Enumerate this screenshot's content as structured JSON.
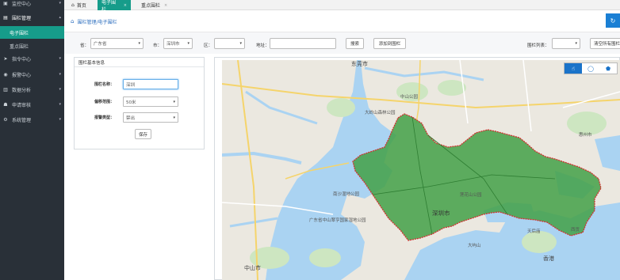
{
  "sidebar": {
    "items": [
      {
        "label": "监控中心",
        "icon": "monitor-icon"
      },
      {
        "label": "围栏管理",
        "icon": "fence-icon"
      },
      {
        "label": "指令中心",
        "icon": "command-icon"
      },
      {
        "label": "报警中心",
        "icon": "alarm-icon"
      },
      {
        "label": "数据分析",
        "icon": "chart-icon"
      },
      {
        "label": "申请审核",
        "icon": "review-icon"
      },
      {
        "label": "系统管理",
        "icon": "settings-icon"
      }
    ],
    "sub_items": [
      {
        "label": "电子围栏",
        "active": true
      },
      {
        "label": "重点围栏",
        "active": false
      }
    ]
  },
  "tabs": [
    {
      "label": "首页",
      "icon": "home-icon"
    },
    {
      "label": "电子围栏",
      "active": true
    },
    {
      "label": "重点围栏"
    }
  ],
  "breadcrumb": "围栏管理/电子围栏",
  "filter": {
    "province_label": "省：",
    "province_value": "广东省",
    "city_label": "市：",
    "city_value": "深圳市",
    "district_label": "区：",
    "district_value": "",
    "address_label": "地址：",
    "address_value": "",
    "search_button": "搜索",
    "add_button": "添加到围栏",
    "fence_list_label": "围栏列表：",
    "fence_list_value": "",
    "clear_button": "清空所有围栏"
  },
  "panel": {
    "title": "围栏基本信息",
    "name_label": "围栏名称：",
    "name_value": "深圳",
    "deviation_label": "偏移范围：",
    "deviation_value": "50米",
    "alarm_label": "报警类型：",
    "alarm_value": "禁出",
    "save_button": "保存"
  },
  "map": {
    "tools": [
      "hand-icon",
      "circle-icon",
      "polygon-icon"
    ],
    "labels": [
      {
        "text": "东莞市",
        "cls": "city"
      },
      {
        "text": "深圳市",
        "cls": "big"
      },
      {
        "text": "中山市",
        "cls": "city"
      },
      {
        "text": "香港",
        "cls": "city"
      },
      {
        "text": "中山公园",
        "cls": ""
      },
      {
        "text": "大岭山森林公园",
        "cls": ""
      },
      {
        "text": "莲花山公园",
        "cls": ""
      },
      {
        "text": "惠州市",
        "cls": ""
      },
      {
        "text": "南沙湿地公园",
        "cls": ""
      },
      {
        "text": "广东省中山翠亨国家湿地公园",
        "cls": ""
      },
      {
        "text": "大屿山",
        "cls": ""
      },
      {
        "text": "西贡",
        "cls": ""
      },
      {
        "text": "天后庙",
        "cls": ""
      }
    ]
  }
}
